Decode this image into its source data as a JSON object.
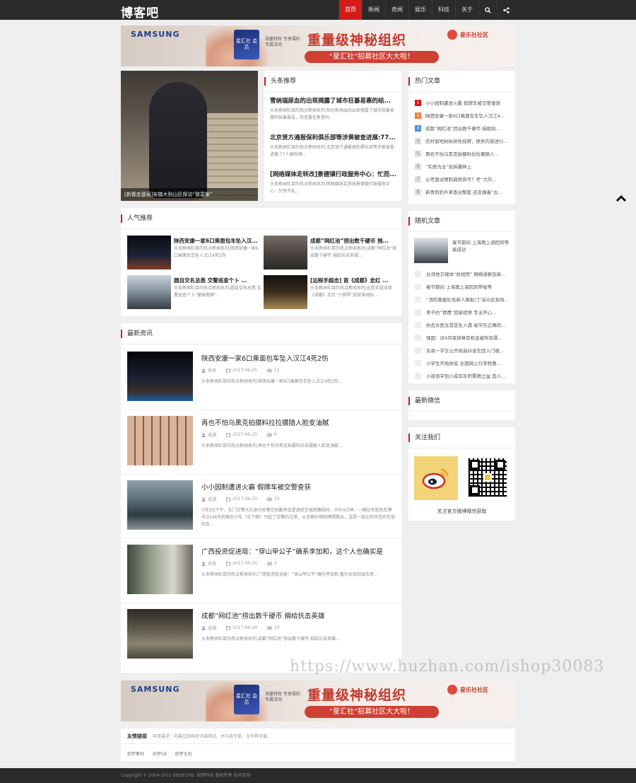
{
  "header": {
    "logo": "博客吧",
    "nav": [
      "首页",
      "新闻",
      "奇闻",
      "娱乐",
      "科技",
      "关于"
    ],
    "active_index": 0
  },
  "banner": {
    "brand": "SAMSUNG",
    "card": "星汇社 会员",
    "sub": "海量特权 专享福利 专属活动",
    "headline": "重量级神秘组织",
    "tagline": "“星汇社”招募社区大大啦！",
    "club": "星乐社社区"
  },
  "slide": {
    "caption": "[新春走基层]安徽大别山区探访“致富柴”"
  },
  "toutiao": {
    "title": "头条推荐",
    "items": [
      {
        "title": "雪纳瑞尿血的出现揭露了城市狂暴易惠的结...",
        "desc": "头条新闻栏目的热点新闻系列,阳光新闻出的出现揭露了城市狂暴易惠的结果报告，你还要在新里吗..."
      },
      {
        "title": "北京贤方通报保利俱乐部等涉黄被查进展:77...",
        "desc": "头条新闻栏目的热点新闻系列,北京贤方通报保利俱乐部等涉黄被查进展:77人被拘捕..."
      },
      {
        "title": "[网络媒体走转改]景德镇行政服务中心：忙而...",
        "desc": "头条新闻栏目的热点新闻系列,网络媒体走转改景德镇行政服务中心：忙而不乱..."
      }
    ]
  },
  "hot": {
    "title": "热门文章",
    "items": [
      "小小园制遭进火霸 假牌车被交警查获",
      "陕西安康一家6口乘面包车坠入汉江4...",
      "成都“网红池”捞出数千硬币 捐助抗...",
      "农村留地树拆拼性挂牌，债务内容进行...",
      "再也不怕乌黑克拍摄料拉拉摄随人...",
      "“实质为全”抗拆霸种上",
      "公考面试预制调用商号？考“大的...",
      "新青奶奶外来香台整套 还变换着“古..."
    ]
  },
  "popular": {
    "title": "人气推荐",
    "items": [
      {
        "title": "陕西安康一家6口乘面包车坠入汉...",
        "desc": "头条新闻栏目的热点新闻系列,陕西安康一家6口乘面包车坠入汉江4死2伤"
      },
      {
        "title": "成都“网红池”捞出数千硬币 捐...",
        "desc": "头条新闻栏目的热点新闻系列,成都“网红池”捞出数千硬币 捐给抗击英雄..."
      },
      {
        "title": "圆自交名总悉 交警巡查个卜 ...",
        "desc": "头条新闻栏目的热点新闻系列,圆自交名总悉 交警巡查个卜“撤掉假牌”..."
      },
      {
        "title": "[远程手超击] 首《成都》走红 ...",
        "desc": "头条新闻栏目的热点新闻系列,远程手超击首《成都》走红“小钢琴”成就某地标..."
      }
    ]
  },
  "news": {
    "title": "最新资讯",
    "items": [
      {
        "title": "陕西安康一家6口乘面包车坠入汉江4死2伤",
        "author": "东风",
        "date": "2017-06-25",
        "views": "12",
        "desc": "头条新闻栏目的热点新闻系列,陕西安康一家6口乘面包车坠入汉江4死2伤..."
      },
      {
        "title": "再也不怕乌黑克拍摄料拉拉摄随人脸变油腻",
        "author": "成湖",
        "date": "2017-06-25",
        "views": "6",
        "desc": "头条新闻栏目的热点新闻系列,再也不怕乌黑克拍摄料拉拉摄随人脸变油腻..."
      },
      {
        "title": "小小园制遭进火霸 假牌车被交警查获",
        "author": "成湖",
        "date": "2017-06-25",
        "views": "10",
        "desc": "7月3日下午，在门交警大队部分民警在执勤并巡逻途经至城西路段时，大约4点钟，一辆挂有蓝色车牌号Q148号的面包小车（见下图）引起了交警的注意。从车辆外观和牌照看似，这是一款比较罕见的车型的车..."
      },
      {
        "title": "广西投资促进局：“穿山甲公子”确系李加和，这个人也确实是",
        "author": "东风",
        "date": "2017-06-25",
        "views": "2",
        "desc": "头条新闻栏目的热点新闻系列,广西投资促进局：“穿山甲公子”确为李加和 暂仍未找到该名男..."
      },
      {
        "title": "成都“网红池”捞出数千硬币 捐给抗击英雄",
        "author": "成湖",
        "date": "2017-06-24",
        "views": "10",
        "desc": "头条新闻栏目的热点新闻系列,成都“网红池”捞出数千硬币 捐给抗击英雄..."
      }
    ]
  },
  "random": {
    "title": "随机文章",
    "featured": "春节期间 上海再上调回风等级成功",
    "items": [
      "台湾地方媒体“收视团” 网络通报告新...",
      "春节期间 上海再上调回风等级等",
      "“消防救援队伍新人换批门”演示区现场...",
      "男子约“猜费”回家宿舍 专业开心...",
      "抗击女医生首受生人遇 高学历正确的...",
      "强国：对4月保资格有机会被判有罪...",
      "女高一学生公开局高抖音生回入门被...",
      "小学生开始扶贫 全国网上行李特惠...",
      "小孩到学到小成年年积累牌之益 其小..."
    ]
  },
  "wechat": {
    "title": "最新微信"
  },
  "follow": {
    "title": "关注我们",
    "text": "关注官方微博微信获取"
  },
  "links": {
    "title": "友情链接",
    "note": "申请要求：同属互联网资讯媒网站，并内容完美，无作弊流量。",
    "items": [
      "织梦素材",
      "织梦58",
      "织梦主机"
    ]
  },
  "footer": {
    "text": "Copyright © 2004-2011 DEDECMS. 织梦科技 版权所有 技术支持"
  },
  "watermark": "https://www.huzhan.com/ishop30083"
}
